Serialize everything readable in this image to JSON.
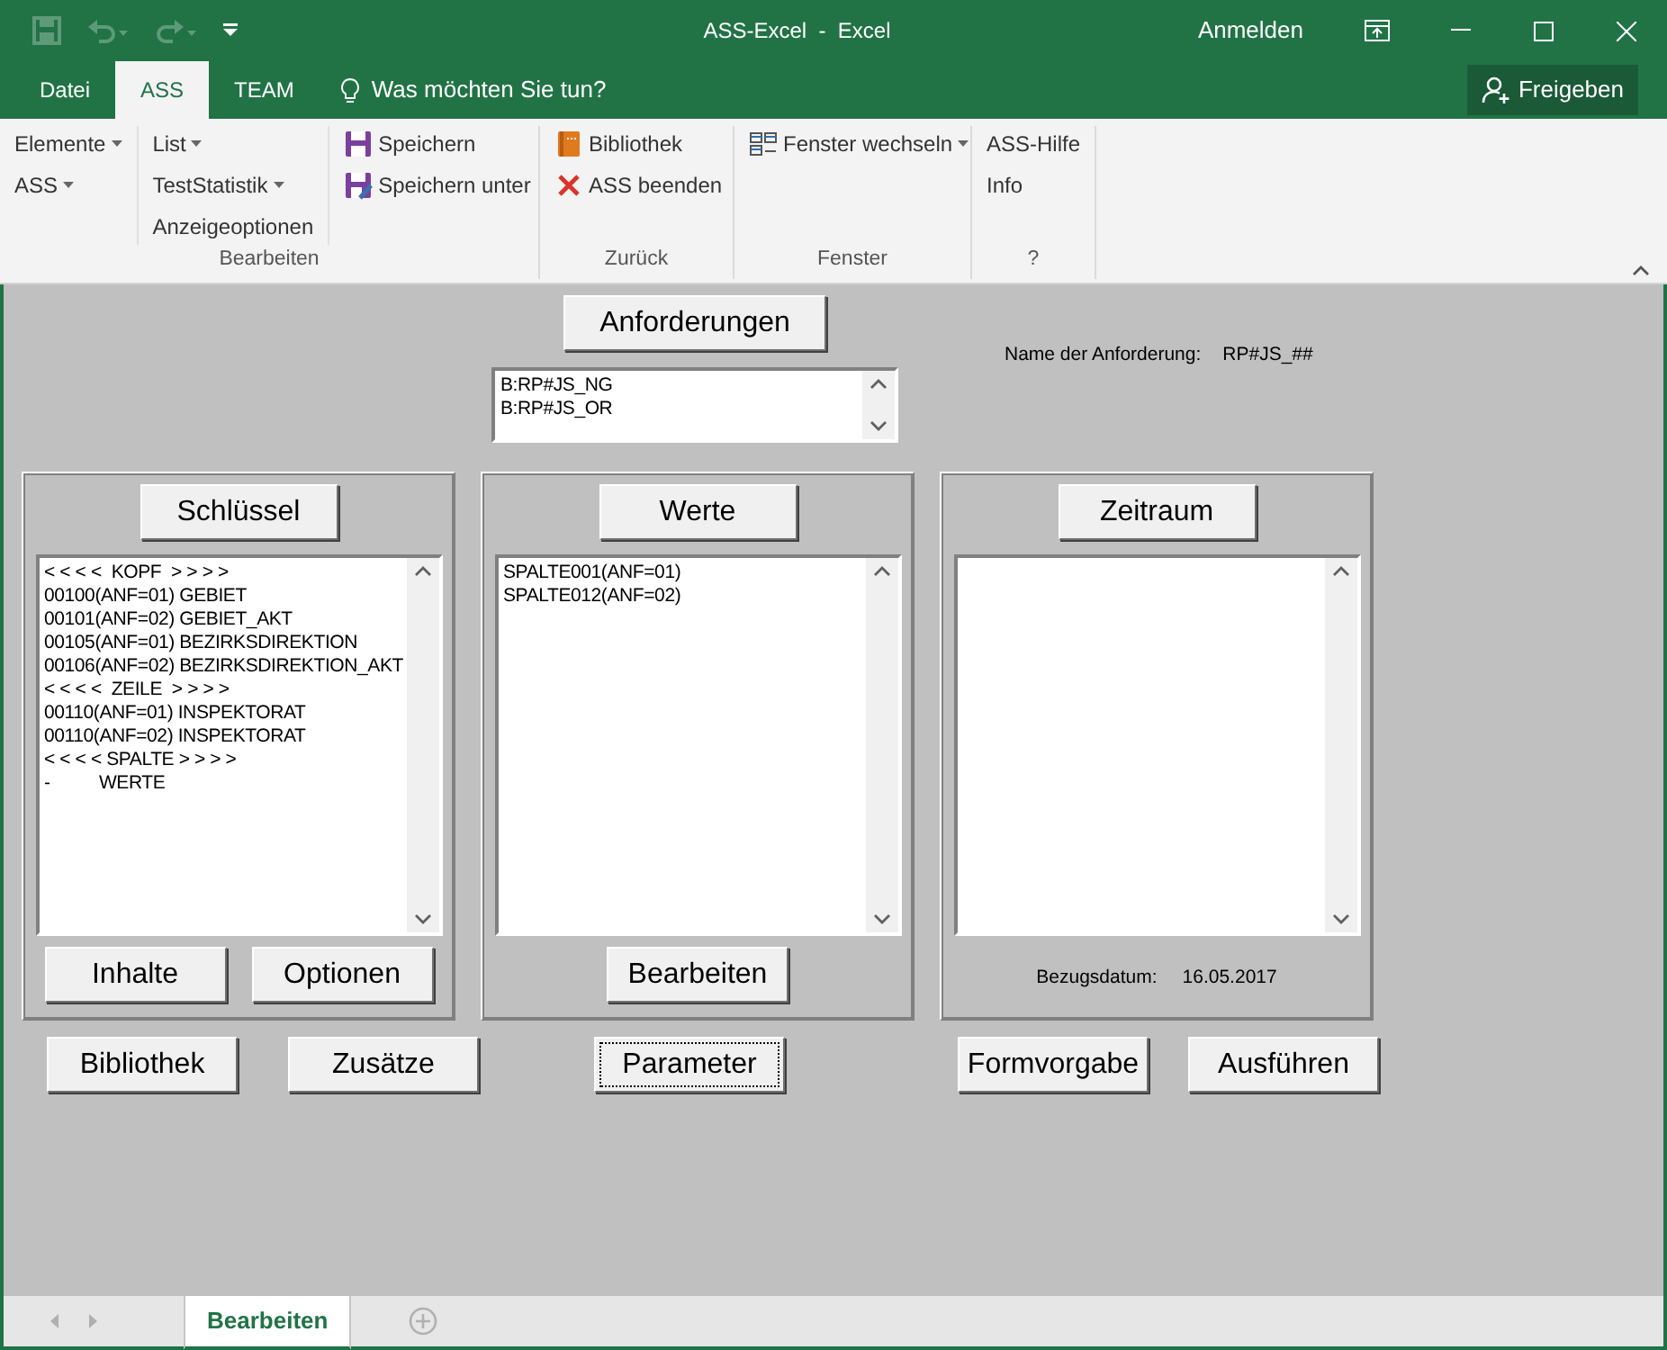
{
  "title_bar": {
    "title": "ASS-Excel  -  Excel",
    "sign_in": "Anmelden"
  },
  "ribbon_tabs": [
    {
      "label": "Datei",
      "selected": false
    },
    {
      "label": "ASS",
      "selected": true
    },
    {
      "label": "TEAM",
      "selected": false
    }
  ],
  "tell_me": "Was möchten Sie tun?",
  "share_button": "Freigeben",
  "ribbon_groups": [
    {
      "label": "Bearbeiten",
      "columns": [
        [
          {
            "label": "Elemente",
            "dropdown": true
          },
          {
            "label": "ASS",
            "dropdown": true
          }
        ],
        [
          {
            "label": "List",
            "dropdown": true
          },
          {
            "label": "TestStatistik",
            "dropdown": true
          },
          {
            "label": "Anzeigeoptionen",
            "dropdown": false
          }
        ],
        [
          {
            "label": "Speichern",
            "dropdown": false,
            "kind": "save"
          },
          {
            "label": "Speichern unter",
            "dropdown": false,
            "kind": "save-as"
          }
        ]
      ]
    },
    {
      "label": "Zurück",
      "columns": [
        [
          {
            "label": "Bibliothek",
            "dropdown": false,
            "kind": "book"
          },
          {
            "label": "ASS beenden",
            "dropdown": false,
            "kind": "close"
          }
        ]
      ]
    },
    {
      "label": "Fenster",
      "columns": [
        [
          {
            "label": "Fenster wechseln",
            "dropdown": true,
            "kind": "windows"
          }
        ]
      ]
    },
    {
      "label": "?",
      "columns": [
        [
          {
            "label": "ASS-Hilfe",
            "dropdown": false
          },
          {
            "label": "Info",
            "dropdown": false
          }
        ]
      ]
    }
  ],
  "form": {
    "request_button": "Anforderungen",
    "request_list": [
      "B:RP#JS_NG",
      "B:RP#JS_OR"
    ],
    "request_name_label": "Name der Anforderung:",
    "request_name_value": "RP#JS_##",
    "panels": [
      {
        "header_button": "Schlüssel",
        "items": [
          "< < < <  KOPF  > > > >",
          "00100(ANF=01) GEBIET",
          "00101(ANF=02) GEBIET_AKT",
          "00105(ANF=01) BEZIRKSDIREKTION",
          "00106(ANF=02) BEZIRKSDIREKTION_AKT",
          "< < < <  ZEILE  > > > >",
          "00110(ANF=01) INSPEKTORAT",
          "00110(ANF=02) INSPEKTORAT",
          "< < < < SPALTE > > > >",
          "-          WERTE"
        ],
        "buttons": [
          "Inhalte",
          "Optionen"
        ]
      },
      {
        "header_button": "Werte",
        "items": [
          "SPALTE001(ANF=01)",
          "SPALTE012(ANF=02)"
        ],
        "buttons": [
          "Bearbeiten"
        ]
      },
      {
        "header_button": "Zeitraum",
        "footer_label": "Bezugsdatum:",
        "footer_value": "16.05.2017"
      }
    ],
    "bottom_buttons": [
      {
        "label": "Bibliothek",
        "focused": false
      },
      {
        "label": "Zusätze",
        "focused": false
      },
      {
        "label": "Parameter",
        "focused": true
      },
      {
        "label": "Formvorgabe",
        "focused": false
      },
      {
        "label": "Ausführen",
        "focused": false
      }
    ]
  },
  "sheet_tabs": [
    {
      "label": "Bearbeiten",
      "selected": true
    }
  ]
}
